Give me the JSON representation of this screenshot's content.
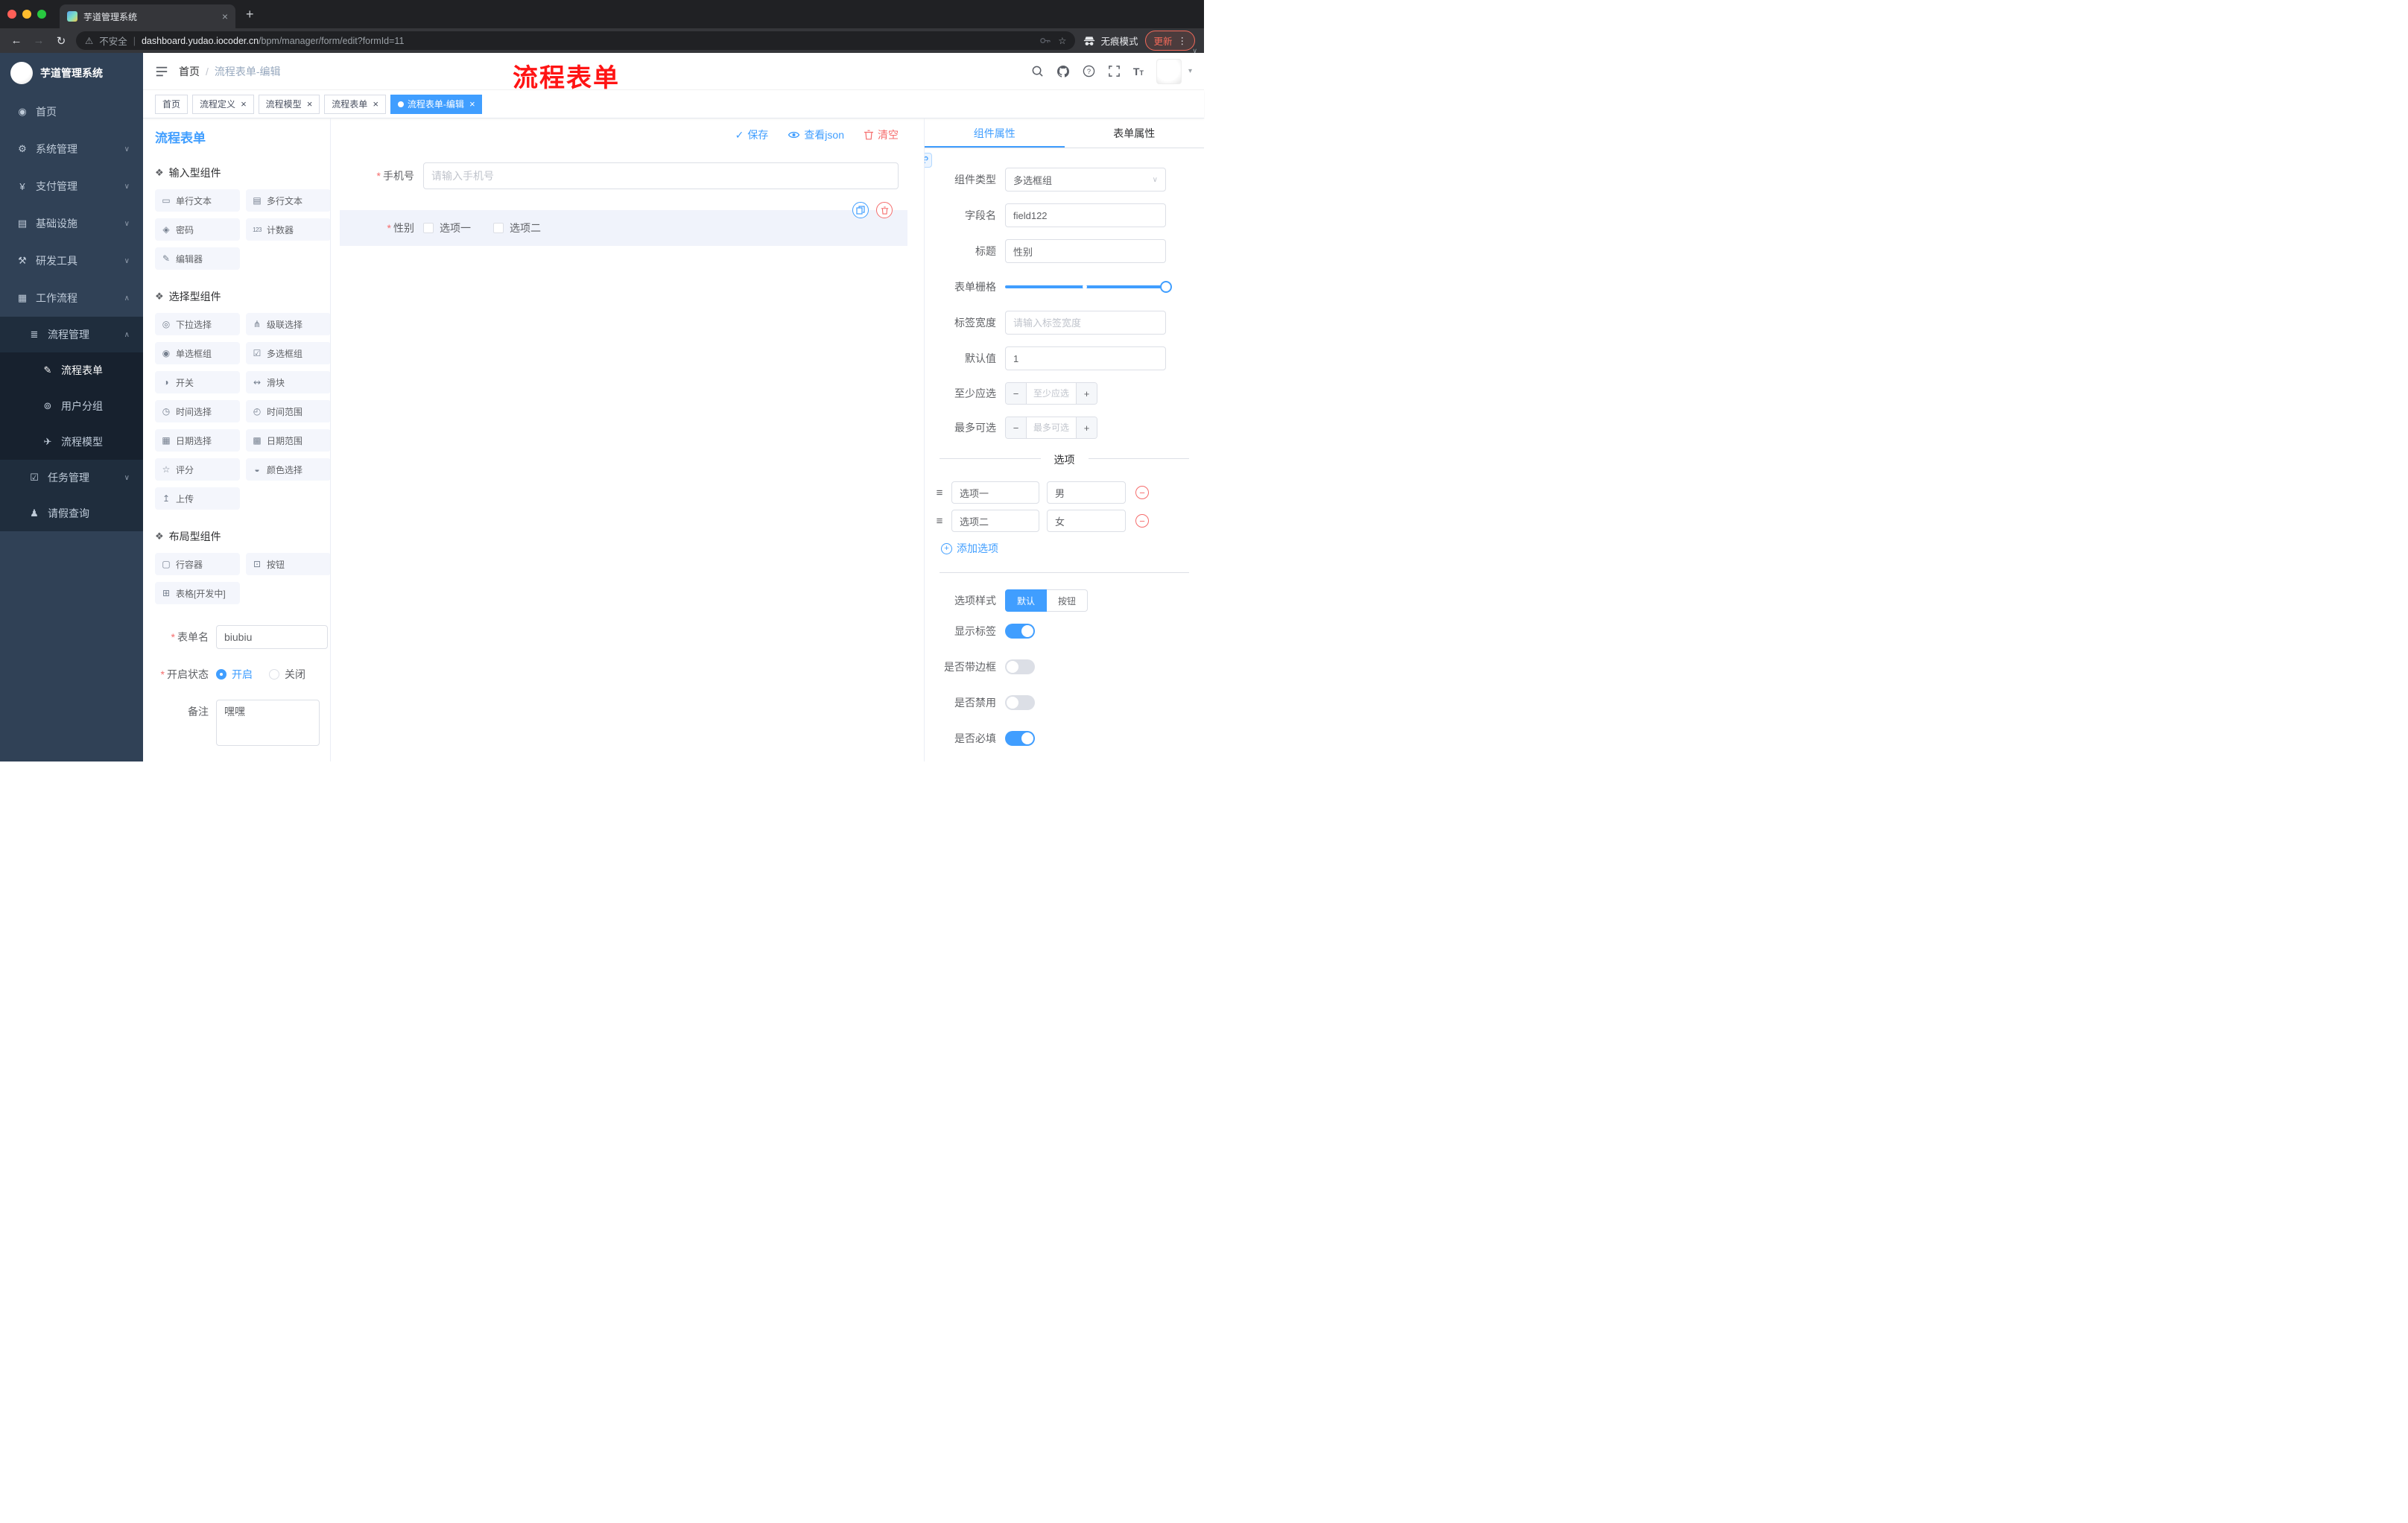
{
  "browser": {
    "tab_title": "芋道管理系统",
    "security_label": "不安全",
    "url_domain": "dashboard.yudao.iocoder.cn",
    "url_path": "/bpm/manager/form/edit?formId=11",
    "incognito_label": "无痕模式",
    "update_label": "更新"
  },
  "sidebar": {
    "logo_title": "芋道管理系统",
    "items": [
      {
        "key": "home",
        "label": "首页",
        "icon": "home-icon",
        "glyph": "◉",
        "level": 1
      },
      {
        "key": "system",
        "label": "系统管理",
        "icon": "gear-icon",
        "glyph": "⚙",
        "level": 1,
        "arrow": "down"
      },
      {
        "key": "payment",
        "label": "支付管理",
        "icon": "payment-icon",
        "glyph": "¥",
        "level": 1,
        "arrow": "down"
      },
      {
        "key": "infrastructure",
        "label": "基础设施",
        "icon": "infrastructure-icon",
        "glyph": "▤",
        "level": 1,
        "arrow": "down"
      },
      {
        "key": "devtools",
        "label": "研发工具",
        "icon": "devtools-icon",
        "glyph": "⚒",
        "level": 1,
        "arrow": "down"
      },
      {
        "key": "workflow",
        "label": "工作流程",
        "icon": "workflow-icon",
        "glyph": "▦",
        "level": 1,
        "arrow": "up"
      },
      {
        "key": "process-mgmt",
        "label": "流程管理",
        "icon": "process-mgmt-icon",
        "glyph": "≣",
        "level": 2,
        "arrow": "up"
      },
      {
        "key": "process-form",
        "label": "流程表单",
        "icon": "process-form-icon",
        "glyph": "✎",
        "level": 3,
        "active": true
      },
      {
        "key": "user-group",
        "label": "用户分组",
        "icon": "user-group-icon",
        "glyph": "⊚",
        "level": 3
      },
      {
        "key": "process-model",
        "label": "流程模型",
        "icon": "process-model-icon",
        "glyph": "✈",
        "level": 3
      },
      {
        "key": "task-mgmt",
        "label": "任务管理",
        "icon": "task-mgmt-icon",
        "glyph": "☑",
        "level": 2,
        "arrow": "down"
      },
      {
        "key": "leave-query",
        "label": "请假查询",
        "icon": "leave-query-icon",
        "glyph": "♟",
        "level": 2
      }
    ]
  },
  "navbar": {
    "breadcrumb": [
      "首页",
      "流程表单-编辑"
    ],
    "annotation": "流程表单"
  },
  "tags": [
    {
      "key": "home",
      "label": "首页",
      "closable": false,
      "active": false
    },
    {
      "key": "process-definition",
      "label": "流程定义",
      "closable": true,
      "active": false
    },
    {
      "key": "process-model",
      "label": "流程模型",
      "closable": true,
      "active": false
    },
    {
      "key": "process-form",
      "label": "流程表单",
      "closable": true,
      "active": false
    },
    {
      "key": "process-form-edit",
      "label": "流程表单-编辑",
      "closable": true,
      "active": true
    }
  ],
  "designer": {
    "title": "流程表单",
    "actions": {
      "save": "保存",
      "view_json": "查看json",
      "clear": "清空"
    },
    "groups": [
      {
        "key": "input",
        "title": "输入型组件",
        "items": [
          {
            "key": "single-line-text",
            "label": "单行文本",
            "icon": "single-line-text-icon",
            "glyph": "▭"
          },
          {
            "key": "multi-line-text",
            "label": "多行文本",
            "icon": "multi-line-text-icon",
            "glyph": "▤"
          },
          {
            "key": "password",
            "label": "密码",
            "icon": "password-icon",
            "glyph": "◈"
          },
          {
            "key": "counter",
            "label": "计数器",
            "icon": "counter-icon",
            "glyph": "123"
          },
          {
            "key": "editor",
            "label": "编辑器",
            "icon": "editor-icon",
            "glyph": "✎"
          }
        ]
      },
      {
        "key": "select",
        "title": "选择型组件",
        "items": [
          {
            "key": "dropdown",
            "label": "下拉选择",
            "icon": "dropdown-icon",
            "glyph": "◎"
          },
          {
            "key": "cascader",
            "label": "级联选择",
            "icon": "cascader-icon",
            "glyph": "⋔"
          },
          {
            "key": "radio-group",
            "label": "单选框组",
            "icon": "radio-group-icon",
            "glyph": "◉"
          },
          {
            "key": "checkbox-group",
            "label": "多选框组",
            "icon": "checkbox-group-icon",
            "glyph": "☑"
          },
          {
            "key": "switch",
            "label": "开关",
            "icon": "switch-icon",
            "glyph": "◑"
          },
          {
            "key": "slider",
            "label": "滑块",
            "icon": "slider-icon",
            "glyph": "↭"
          },
          {
            "key": "time-picker",
            "label": "时间选择",
            "icon": "time-picker-icon",
            "glyph": "◷"
          },
          {
            "key": "time-range",
            "label": "时间范围",
            "icon": "time-range-icon",
            "glyph": "◴"
          },
          {
            "key": "date-picker",
            "label": "日期选择",
            "icon": "date-picker-icon",
            "glyph": "▦"
          },
          {
            "key": "date-range",
            "label": "日期范围",
            "icon": "date-range-icon",
            "glyph": "▩"
          },
          {
            "key": "rate",
            "label": "评分",
            "icon": "rate-icon",
            "glyph": "☆"
          },
          {
            "key": "color-picker",
            "label": "颜色选择",
            "icon": "color-picker-icon",
            "glyph": "◒"
          },
          {
            "key": "upload",
            "label": "上传",
            "icon": "upload-icon",
            "glyph": "↥"
          }
        ]
      },
      {
        "key": "layout",
        "title": "布局型组件",
        "items": [
          {
            "key": "row-container",
            "label": "行容器",
            "icon": "row-container-icon",
            "glyph": "▢"
          },
          {
            "key": "button",
            "label": "按钮",
            "icon": "button-icon",
            "glyph": "⊡"
          },
          {
            "key": "table",
            "label": "表格[开发中]",
            "icon": "table-icon",
            "glyph": "⊞"
          }
        ]
      }
    ],
    "meta": {
      "name_label": "表单名",
      "name_value": "biubiu",
      "status_label": "开启状态",
      "status_options": [
        {
          "label": "开启",
          "selected": true
        },
        {
          "label": "关闭",
          "selected": false
        }
      ],
      "remark_label": "备注",
      "remark_value": "嘿嘿"
    },
    "canvas": {
      "phone": {
        "label": "手机号",
        "placeholder": "请输入手机号"
      },
      "gender": {
        "label": "性别",
        "options": [
          {
            "label": "选项一",
            "checked": false
          },
          {
            "label": "选项二",
            "checked": false
          }
        ]
      }
    }
  },
  "properties": {
    "tabs": [
      {
        "label": "组件属性",
        "active": true
      },
      {
        "label": "表单属性",
        "active": false
      }
    ],
    "component_type": {
      "label": "组件类型",
      "value": "多选框组"
    },
    "field_name": {
      "label": "字段名",
      "value": "field122"
    },
    "title": {
      "label": "标题",
      "value": "性别"
    },
    "form_grid": {
      "label": "表单栅格"
    },
    "label_width": {
      "label": "标签宽度",
      "placeholder": "请输入标签宽度"
    },
    "default_value": {
      "label": "默认值",
      "value": "1"
    },
    "min_select": {
      "label": "至少应选",
      "placeholder": "至少应选"
    },
    "max_select": {
      "label": "最多可选",
      "placeholder": "最多可选"
    },
    "options_divider": "选项",
    "options": [
      {
        "name": "选项一",
        "value": "男"
      },
      {
        "name": "选项二",
        "value": "女"
      }
    ],
    "add_option_label": "添加选项",
    "option_style": {
      "label": "选项样式",
      "choices": [
        "默认",
        "按钮"
      ],
      "selected": "默认"
    },
    "switches": [
      {
        "key": "show-label",
        "label": "显示标签",
        "on": true
      },
      {
        "key": "with-border",
        "label": "是否带边框",
        "on": false
      },
      {
        "key": "disabled",
        "label": "是否禁用",
        "on": false
      },
      {
        "key": "required",
        "label": "是否必填",
        "on": true
      }
    ]
  },
  "colors": {
    "accent": "#409eff",
    "danger": "#f56c6c",
    "sidebar_bg": "#304156",
    "annotation_red": "#ff1414"
  }
}
